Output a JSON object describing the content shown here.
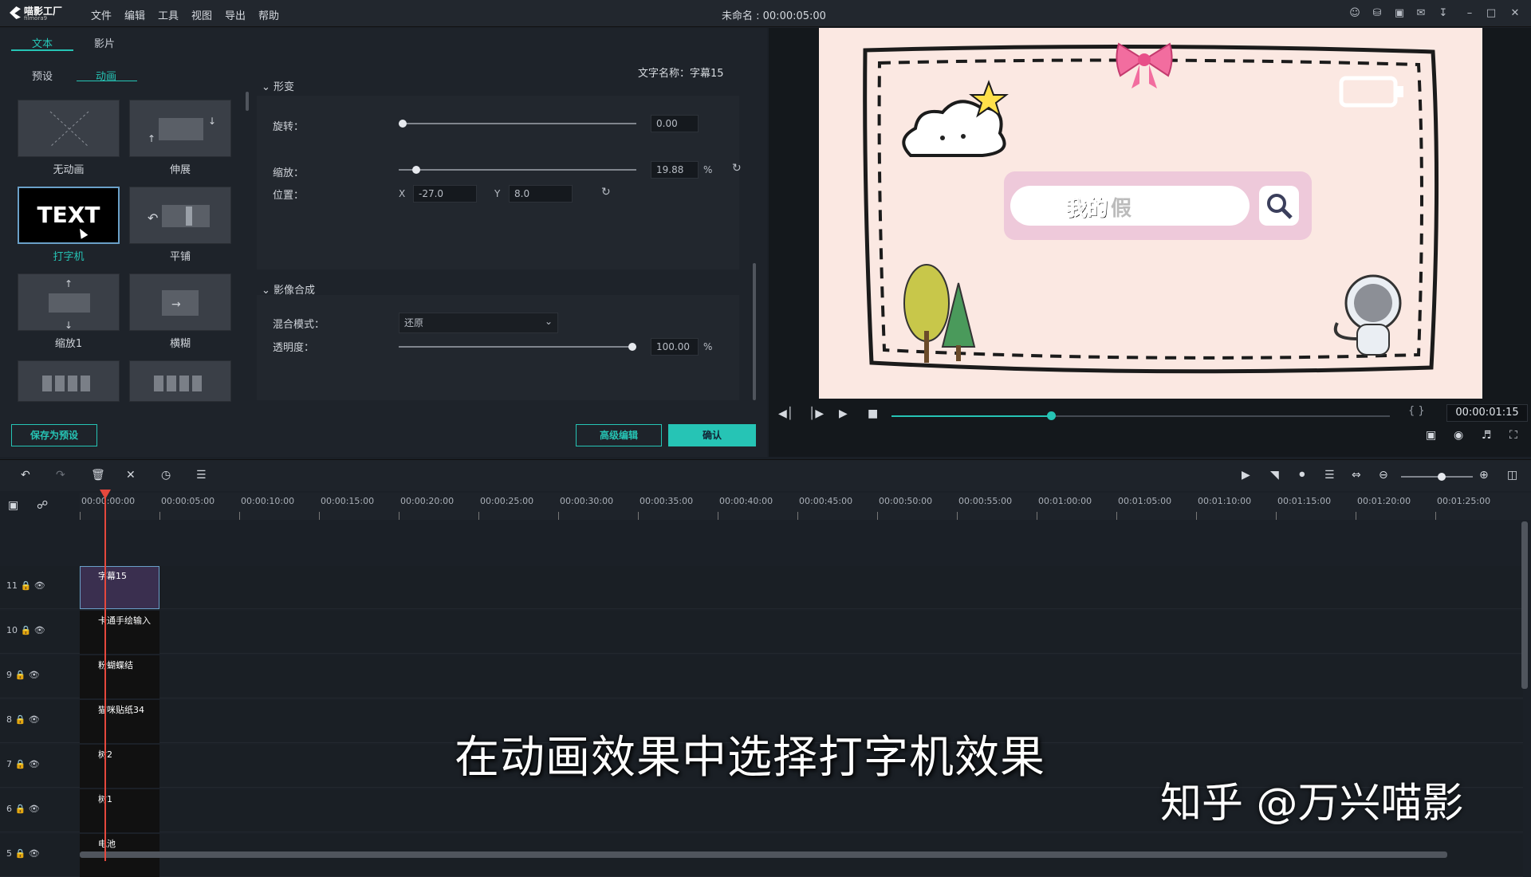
{
  "app": {
    "logo_main": "喵影工厂",
    "logo_sub": "filmora9",
    "project_title": "未命名 : 00:00:05:00"
  },
  "menu": [
    "文件",
    "编辑",
    "工具",
    "视图",
    "导出",
    "帮助"
  ],
  "top_tabs": [
    "文本",
    "影片"
  ],
  "sub_tabs": [
    "预设",
    "动画"
  ],
  "text_name": "文字名称：字幕15",
  "animations": [
    {
      "label": "无动画"
    },
    {
      "label": "伸展"
    },
    {
      "label": "打字机",
      "thumb_text": "TEXT"
    },
    {
      "label": "平铺"
    },
    {
      "label": "缩放1"
    },
    {
      "label": "横糊"
    }
  ],
  "transform": {
    "section": "形变",
    "rotate_label": "旋转：",
    "rotate_value": "0.00",
    "rotate_level": 0.0,
    "scale_label": "缩放：",
    "scale_value": "19.88",
    "scale_unit": "%",
    "scale_level": 0.06,
    "position_label": "位置：",
    "x_label": "X",
    "x_value": "-27.0",
    "y_label": "Y",
    "y_value": "8.0"
  },
  "composite": {
    "section": "影像合成",
    "blend_label": "混合模式：",
    "blend_value": "还原",
    "opacity_label": "透明度：",
    "opacity_value": "100.00",
    "opacity_unit": "%",
    "opacity_level": 1.0
  },
  "buttons": {
    "save_preset": "保存为预设",
    "advanced": "高级编辑",
    "confirm": "确认"
  },
  "preview": {
    "search_text": "我的",
    "search_cursor": "假",
    "timecode": "00:00:01:15",
    "progress": 0.32,
    "brackets": "{ }"
  },
  "ruler": [
    "00:00:00:00",
    "00:00:05:00",
    "00:00:10:00",
    "00:00:15:00",
    "00:00:20:00",
    "00:00:25:00",
    "00:00:30:00",
    "00:00:35:00",
    "00:00:40:00",
    "00:00:45:00",
    "00:00:50:00",
    "00:00:55:00",
    "00:01:00:00",
    "00:01:05:00",
    "00:01:10:00",
    "00:01:15:00",
    "00:01:20:00",
    "00:01:25:00"
  ],
  "tracks": [
    {
      "num": "11",
      "clip": "字幕15"
    },
    {
      "num": "10",
      "clip": "卡通手绘输入"
    },
    {
      "num": "9",
      "clip": "粉蝴蝶结"
    },
    {
      "num": "8",
      "clip": "猫咪贴纸34"
    },
    {
      "num": "7",
      "clip": "树2"
    },
    {
      "num": "6",
      "clip": "树1"
    },
    {
      "num": "5",
      "clip": "电池"
    }
  ],
  "subtitle": "在动画效果中选择打字机效果",
  "watermark": "知乎 @万兴喵影",
  "colors": {
    "accent": "#26c4b5",
    "playhead": "#e5483d",
    "canvas_bg": "#fbe8e2"
  }
}
